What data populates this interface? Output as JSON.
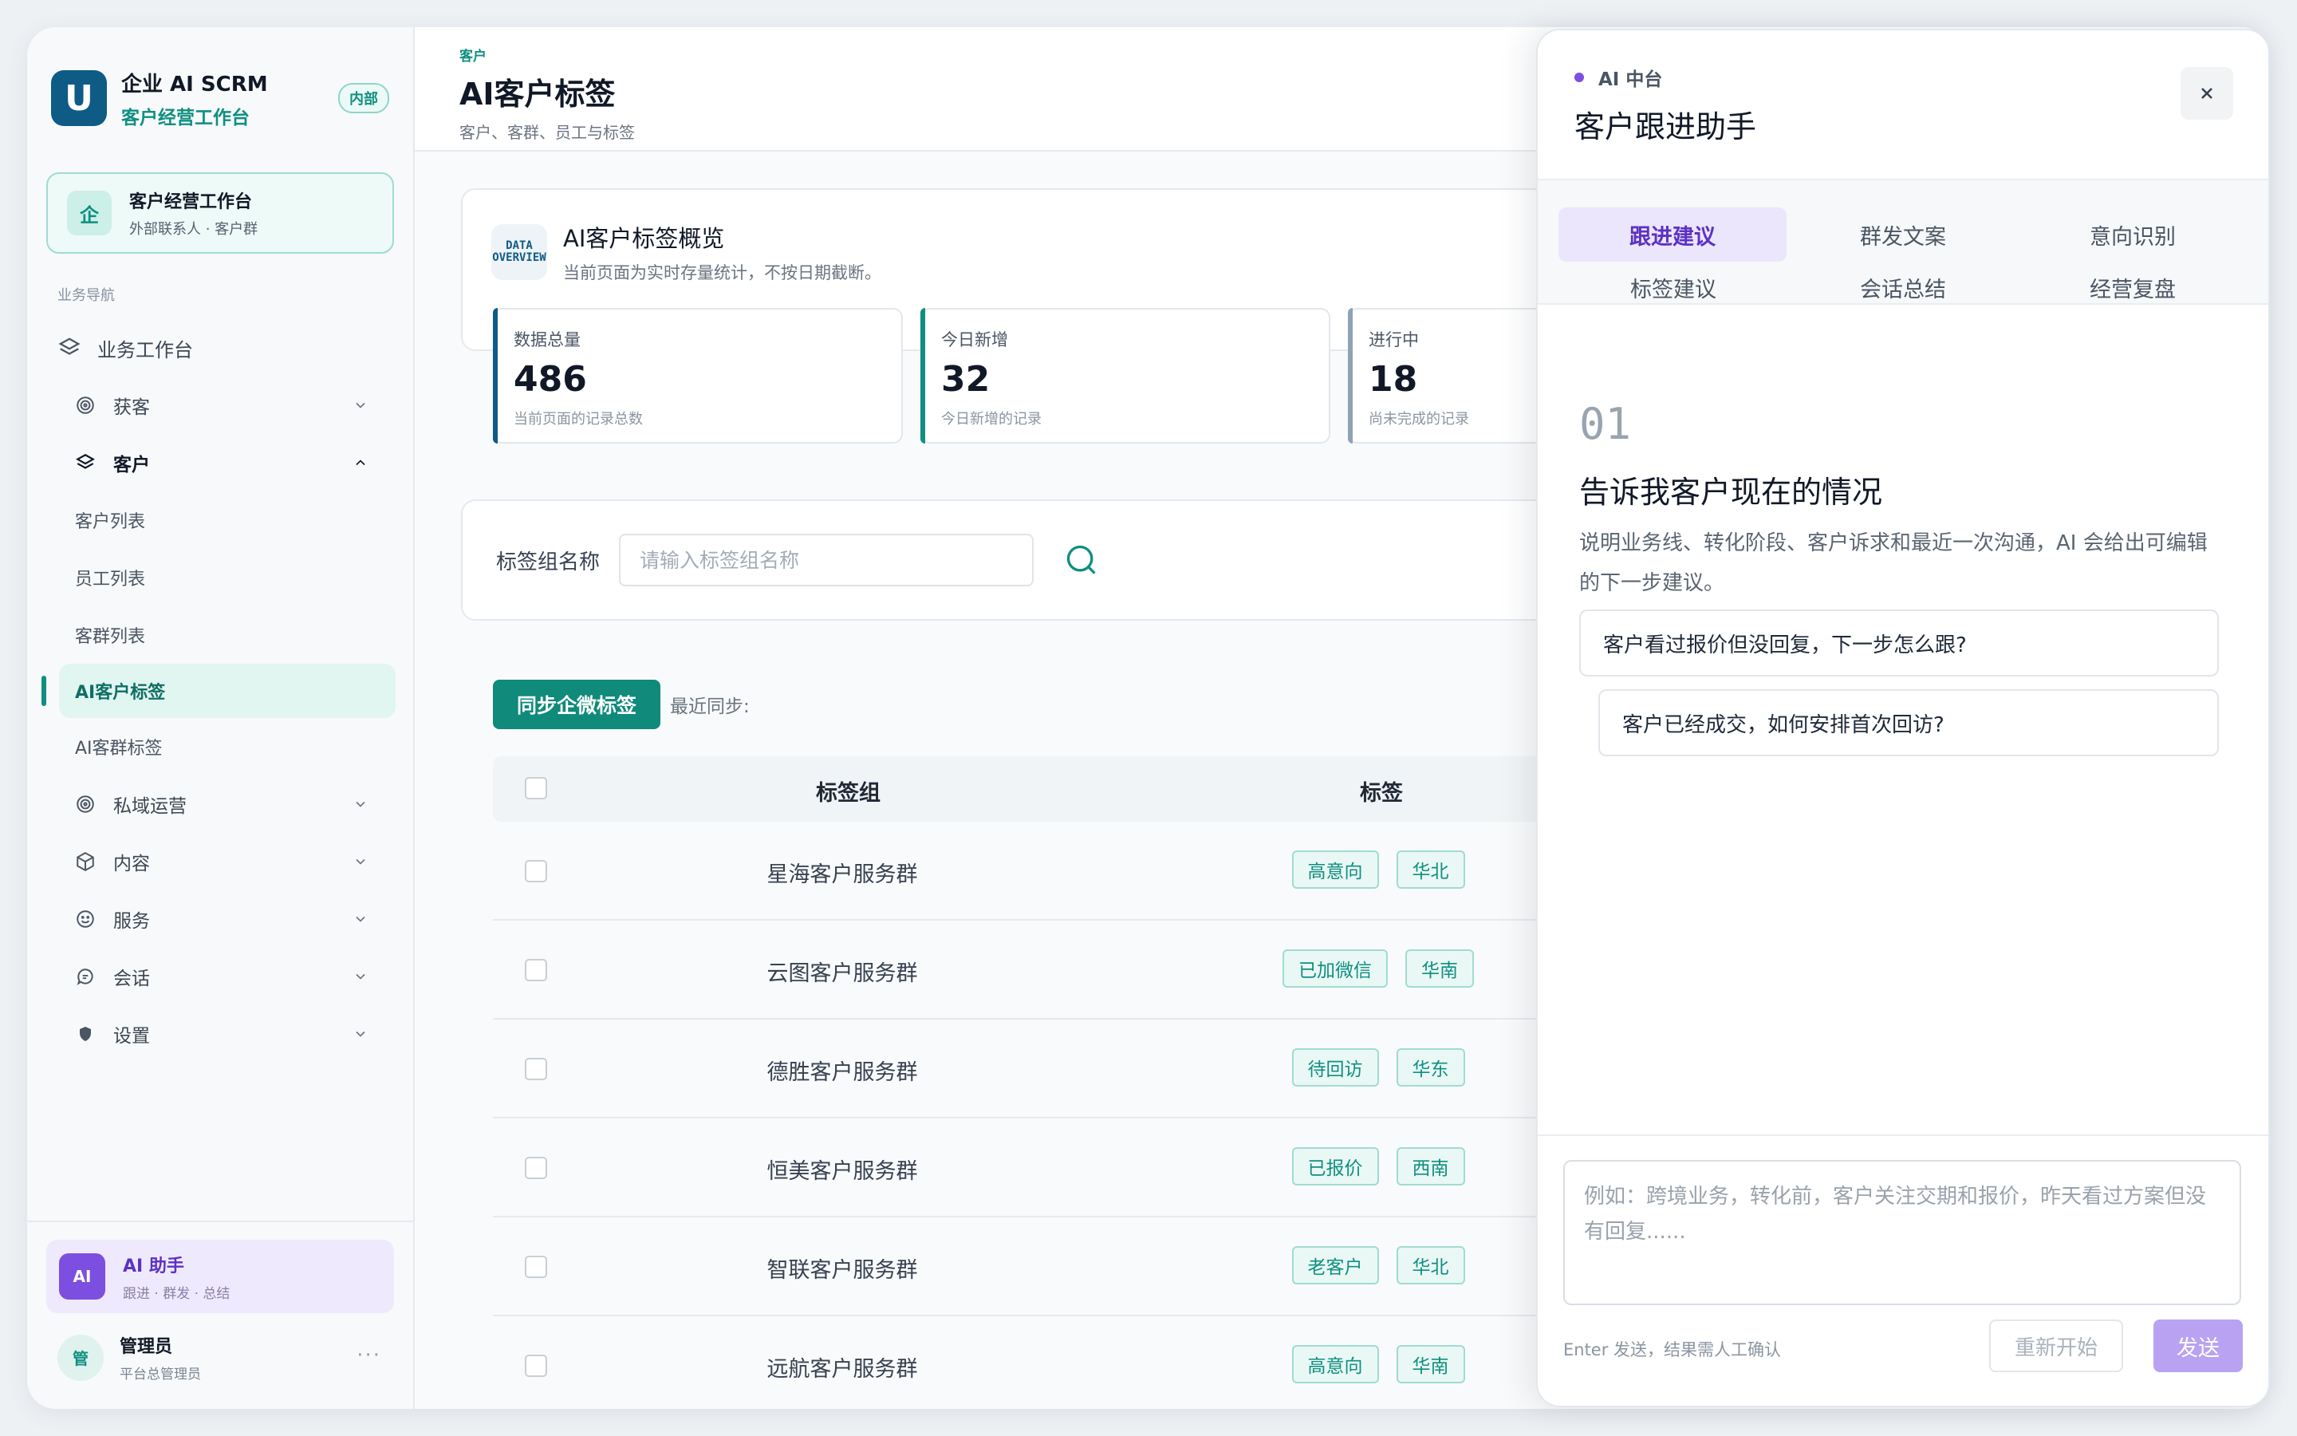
{
  "brand": {
    "logo_letter": "U",
    "title": "企业 AI SCRM",
    "subtitle": "客户经营工作台",
    "badge": "内部"
  },
  "workspace": {
    "icon_char": "企",
    "title": "客户经营工作台",
    "subtitle": "外部联系人 · 客户群"
  },
  "nav": {
    "section": "业务导航",
    "workbench": "业务工作台",
    "acquire": "获客",
    "customer": "客户",
    "customer_list": "客户列表",
    "employee_list": "员工列表",
    "group_list": "客群列表",
    "ai_customer_tags": "AI客户标签",
    "ai_group_tags": "AI客群标签",
    "private_ops": "私域运营",
    "content": "内容",
    "service": "服务",
    "conversation": "会话",
    "settings": "设置"
  },
  "ai_assistant": {
    "badge": "AI",
    "title": "AI 助手",
    "subtitle": "跟进 · 群发 · 总结"
  },
  "user": {
    "avatar_char": "管",
    "name": "管理员",
    "role": "平台总管理员",
    "more": "···"
  },
  "header": {
    "crumb": "客户",
    "title": "AI客户标签",
    "desc": "客户、客群、员工与标签"
  },
  "overview": {
    "icon_line1": "DATA",
    "icon_line2": "OVERVIEW",
    "title": "AI客户标签概览",
    "subtitle": "当前页面为实时存量统计，不按日期截断。",
    "stats": [
      {
        "label": "数据总量",
        "value": "486",
        "note": "当前页面的记录总数"
      },
      {
        "label": "今日新增",
        "value": "32",
        "note": "今日新增的记录"
      },
      {
        "label": "进行中",
        "value": "18",
        "note": "尚未完成的记录"
      }
    ]
  },
  "filter": {
    "label": "标签组名称",
    "placeholder": "请输入标签组名称"
  },
  "sync": {
    "button": "同步企微标签",
    "last_sync_label": "最近同步:"
  },
  "table": {
    "headers": {
      "group": "标签组",
      "tags": "标签"
    },
    "rows": [
      {
        "name": "星海客户服务群",
        "tags": [
          "高意向",
          "华北"
        ]
      },
      {
        "name": "云图客户服务群",
        "tags": [
          "已加微信",
          "华南"
        ]
      },
      {
        "name": "德胜客户服务群",
        "tags": [
          "待回访",
          "华东"
        ]
      },
      {
        "name": "恒美客户服务群",
        "tags": [
          "已报价",
          "西南"
        ]
      },
      {
        "name": "智联客户服务群",
        "tags": [
          "老客户",
          "华北"
        ]
      },
      {
        "name": "远航客户服务群",
        "tags": [
          "高意向",
          "华南"
        ]
      }
    ]
  },
  "panel": {
    "tagline": "AI 中台",
    "title": "客户跟进助手",
    "tabs": [
      "跟进建议",
      "群发文案",
      "意向识别",
      "标签建议",
      "会话总结",
      "经营复盘"
    ],
    "step_number": "01",
    "step_title": "告诉我客户现在的情况",
    "step_desc": "说明业务线、转化阶段、客户诉求和最近一次沟通，AI 会给出可编辑的下一步建议。",
    "suggestions": [
      "客户看过报价但没回复，下一步怎么跟?",
      "客户已经成交，如何安排首次回访?"
    ],
    "compose_placeholder": "例如：跨境业务，转化前，客户关注交期和报价，昨天看过方案但没有回复......",
    "footer_hint": "Enter 发送，结果需人工确认",
    "restart": "重新开始",
    "send": "发送"
  },
  "colors": {
    "brand_teal": "#0f8f80",
    "brand_blue": "#0e5b86",
    "ai_purple": "#7c4fe0"
  }
}
